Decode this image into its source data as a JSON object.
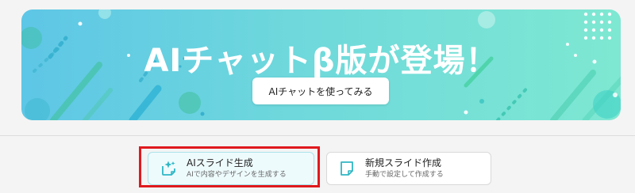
{
  "banner": {
    "title": "AIチャットβ版が登場！",
    "cta_label": "AIチャットを使ってみる"
  },
  "options": [
    {
      "title": "AIスライド生成",
      "subtitle": "AIで内容やデザインを生成する",
      "icon": "sparkle-document-icon",
      "highlighted": true
    },
    {
      "title": "新規スライド作成",
      "subtitle": "手動で設定して作成する",
      "icon": "blank-document-icon",
      "highlighted": false
    }
  ],
  "colors": {
    "banner_left": "#5ec6e6",
    "banner_right": "#7ee8d2",
    "highlight_border": "#e0191d",
    "icon_accent": "#2fb7c5"
  }
}
